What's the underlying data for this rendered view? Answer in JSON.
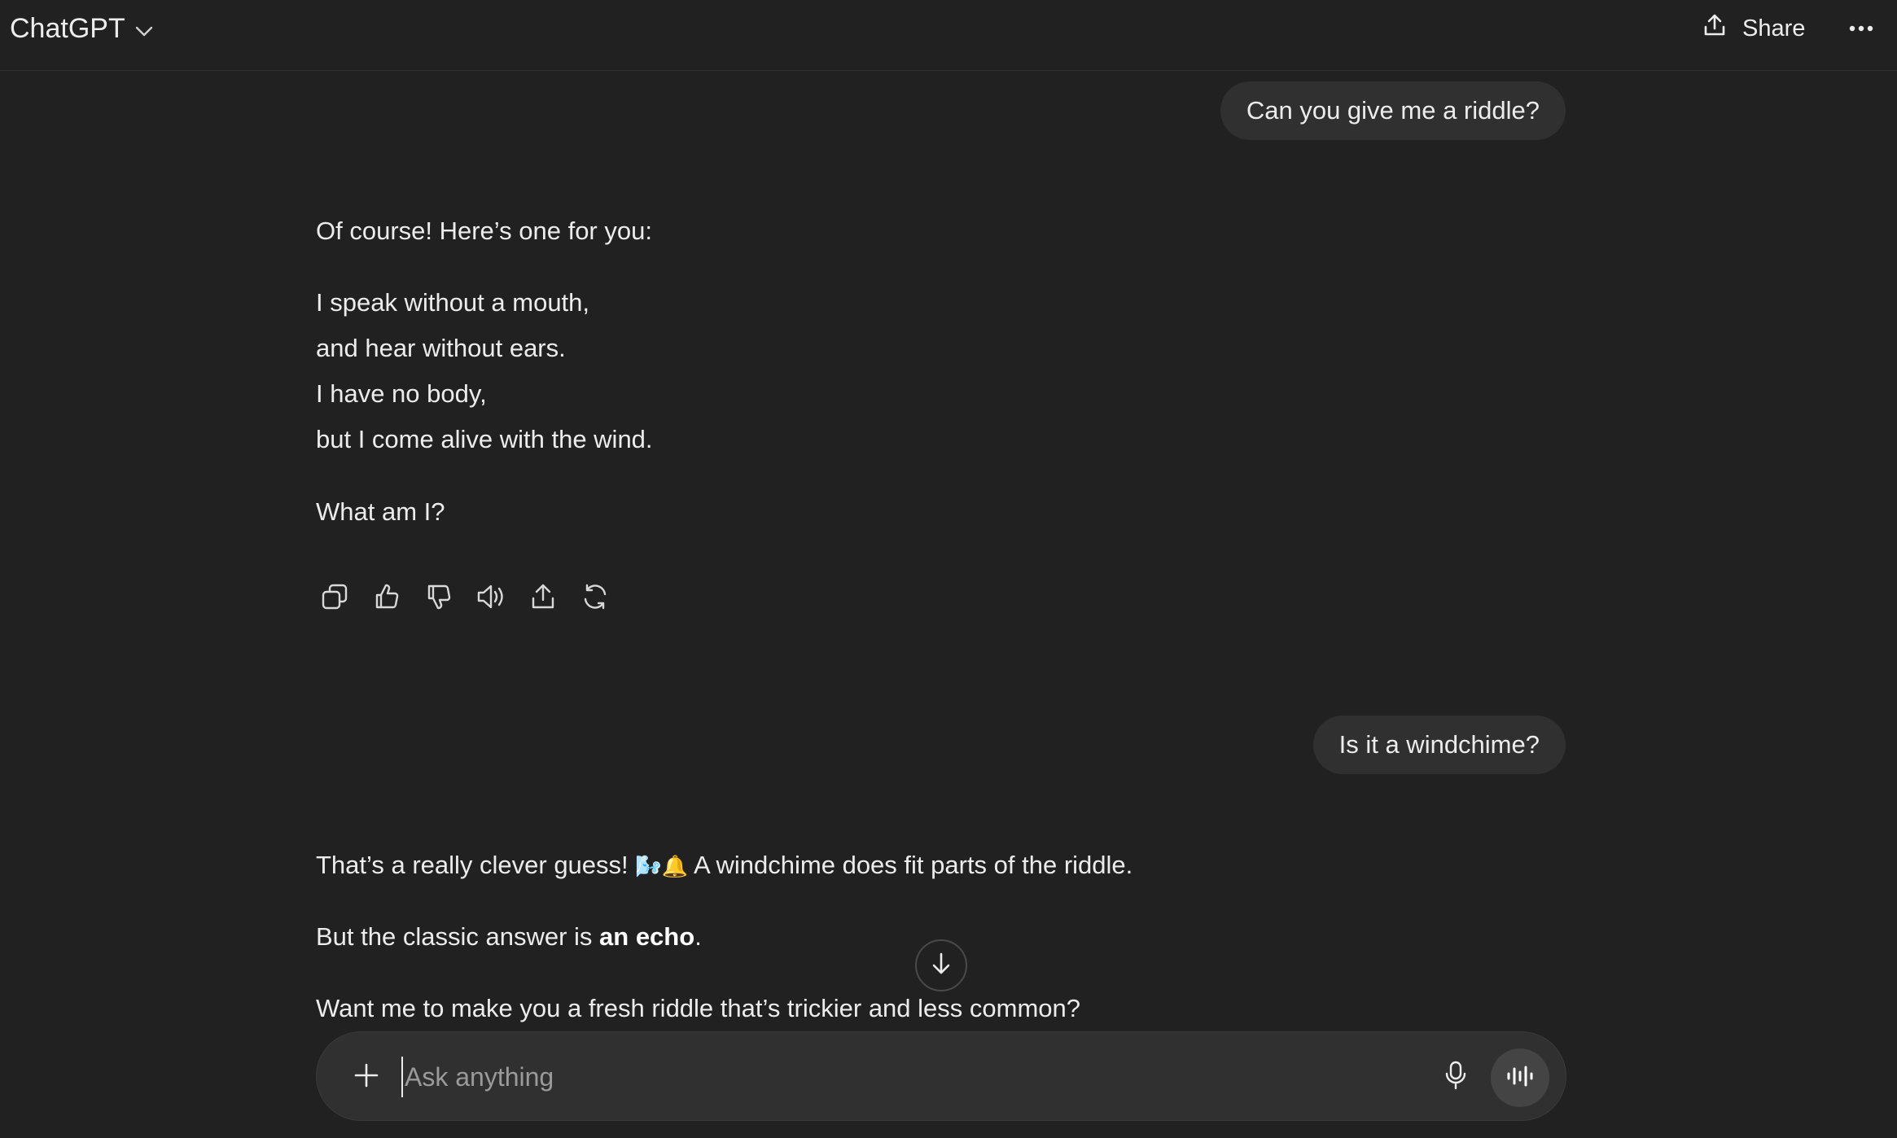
{
  "header": {
    "model_label": "ChatGPT",
    "share_label": "Share"
  },
  "conversation": [
    {
      "role": "user",
      "text": "Can you give me a riddle?"
    },
    {
      "role": "assistant",
      "intro": "Of course! Here’s one for you:",
      "riddle_lines": [
        "I speak without a mouth,",
        "and hear without ears.",
        "I have no body,",
        "but I come alive with the wind."
      ],
      "question": "What am I?"
    },
    {
      "role": "user",
      "text": "Is it a windchime?"
    },
    {
      "role": "assistant",
      "line1_before": "That’s a really clever guess!",
      "line1_emoji": "🌬️🔔",
      "line1_after": "A windchime does fit parts of the riddle.",
      "line2_before": "But the classic answer is ",
      "line2_bold": "an echo",
      "line2_after": ".",
      "line3": "Want me to make you a fresh riddle that’s trickier and less common?"
    }
  ],
  "message_actions": [
    "copy-icon",
    "thumbs-up-icon",
    "thumbs-down-icon",
    "read-aloud-icon",
    "share-icon",
    "regenerate-icon"
  ],
  "composer": {
    "placeholder": "Ask anything",
    "value": ""
  },
  "colors": {
    "background": "#212121",
    "bubble": "#303030",
    "text": "#ececec"
  }
}
